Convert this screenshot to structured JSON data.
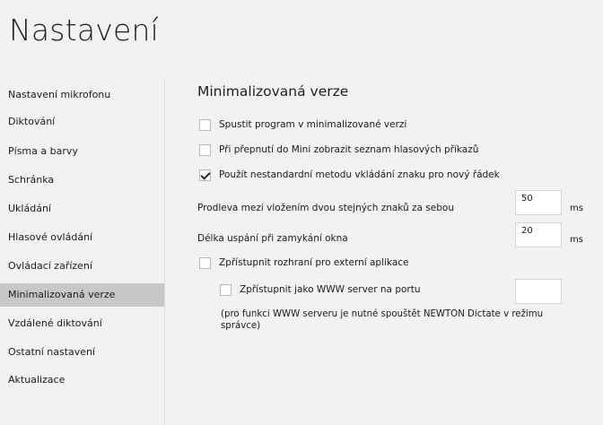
{
  "window": {
    "title": "Nastavení"
  },
  "sidebar": {
    "items": [
      {
        "label": "Nastavení mikrofonu"
      },
      {
        "label": "Diktování"
      },
      {
        "label": "Písma a barvy"
      },
      {
        "label": "Schránka"
      },
      {
        "label": "Ukládání"
      },
      {
        "label": "Hlasové ovládání"
      },
      {
        "label": "Ovládací zařízení"
      },
      {
        "label": "Minimalizovaná verze",
        "selected": true
      },
      {
        "label": "Vzdálené diktování"
      },
      {
        "label": "Ostatní nastavení"
      },
      {
        "label": "Aktualizace"
      }
    ]
  },
  "main": {
    "section_title": "Minimalizovaná verze",
    "options": {
      "start_minimized": {
        "label": "Spustit program v minimalizované verzi",
        "checked": false
      },
      "show_commands": {
        "label": "Při přepnutí do Mini zobrazit seznam hlasových příkazů",
        "checked": false
      },
      "nonstandard_newline": {
        "label": "Použít nestandardní metodu vkládání znaku pro nový řádek",
        "checked": true
      },
      "external_interface": {
        "label": "Zpřístupnit rozhraní pro externí aplikace",
        "checked": false
      },
      "www_server": {
        "label": "Zpřístupnit jako WWW server na portu",
        "checked": false
      }
    },
    "delay": {
      "label": "Prodleva mezi vložením dvou stejných znaků za sebou",
      "value": "50",
      "unit": "ms"
    },
    "sleep": {
      "label": "Délka uspání při zamykání okna",
      "value": "20",
      "unit": "ms"
    },
    "port": {
      "value": ""
    },
    "note": "(pro funkci WWW serveru je nutné spouštět NEWTON Dictate v režimu správce)"
  },
  "colors": {
    "background": "#f2f2f2",
    "selected_item": "#c8c8c8",
    "input_bg": "#ffffff"
  }
}
